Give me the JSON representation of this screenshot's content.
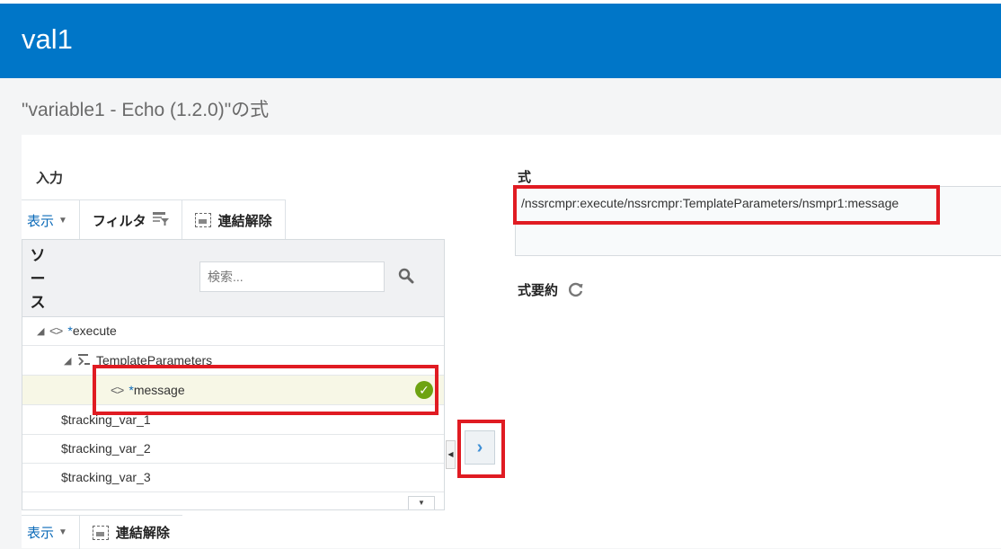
{
  "app": {
    "title": "val1"
  },
  "page": {
    "subtitle": "\"variable1 - Echo (1.2.0)\"の式"
  },
  "input_panel": {
    "label": "入力",
    "toolbar": {
      "view_label": "表示",
      "filter_label": "フィルタ",
      "detach_label": "連結解除"
    },
    "source_header": [
      "ソ",
      "ー",
      "ス"
    ],
    "search": {
      "placeholder": "検索..."
    },
    "tree": [
      {
        "required": "*",
        "name": "execute"
      },
      {
        "name": "TemplateParameters"
      },
      {
        "required": "*",
        "name": "message",
        "selected": true,
        "status": "valid"
      },
      {
        "name": "$tracking_var_1"
      },
      {
        "name": "$tracking_var_2"
      },
      {
        "name": "$tracking_var_3"
      }
    ],
    "bottom_toolbar": {
      "view_label": "表示",
      "detach_label": "連結解除"
    }
  },
  "expression_panel": {
    "label": "式",
    "expression": "/nssrcmpr:execute/nssrcmpr:TemplateParameters/nsmpr1:message",
    "summary_label": "式要約"
  },
  "colors": {
    "title_bar": "#0076c8",
    "highlight": "#e01b22",
    "valid": "#6ea312",
    "link": "#0b6ab8"
  }
}
